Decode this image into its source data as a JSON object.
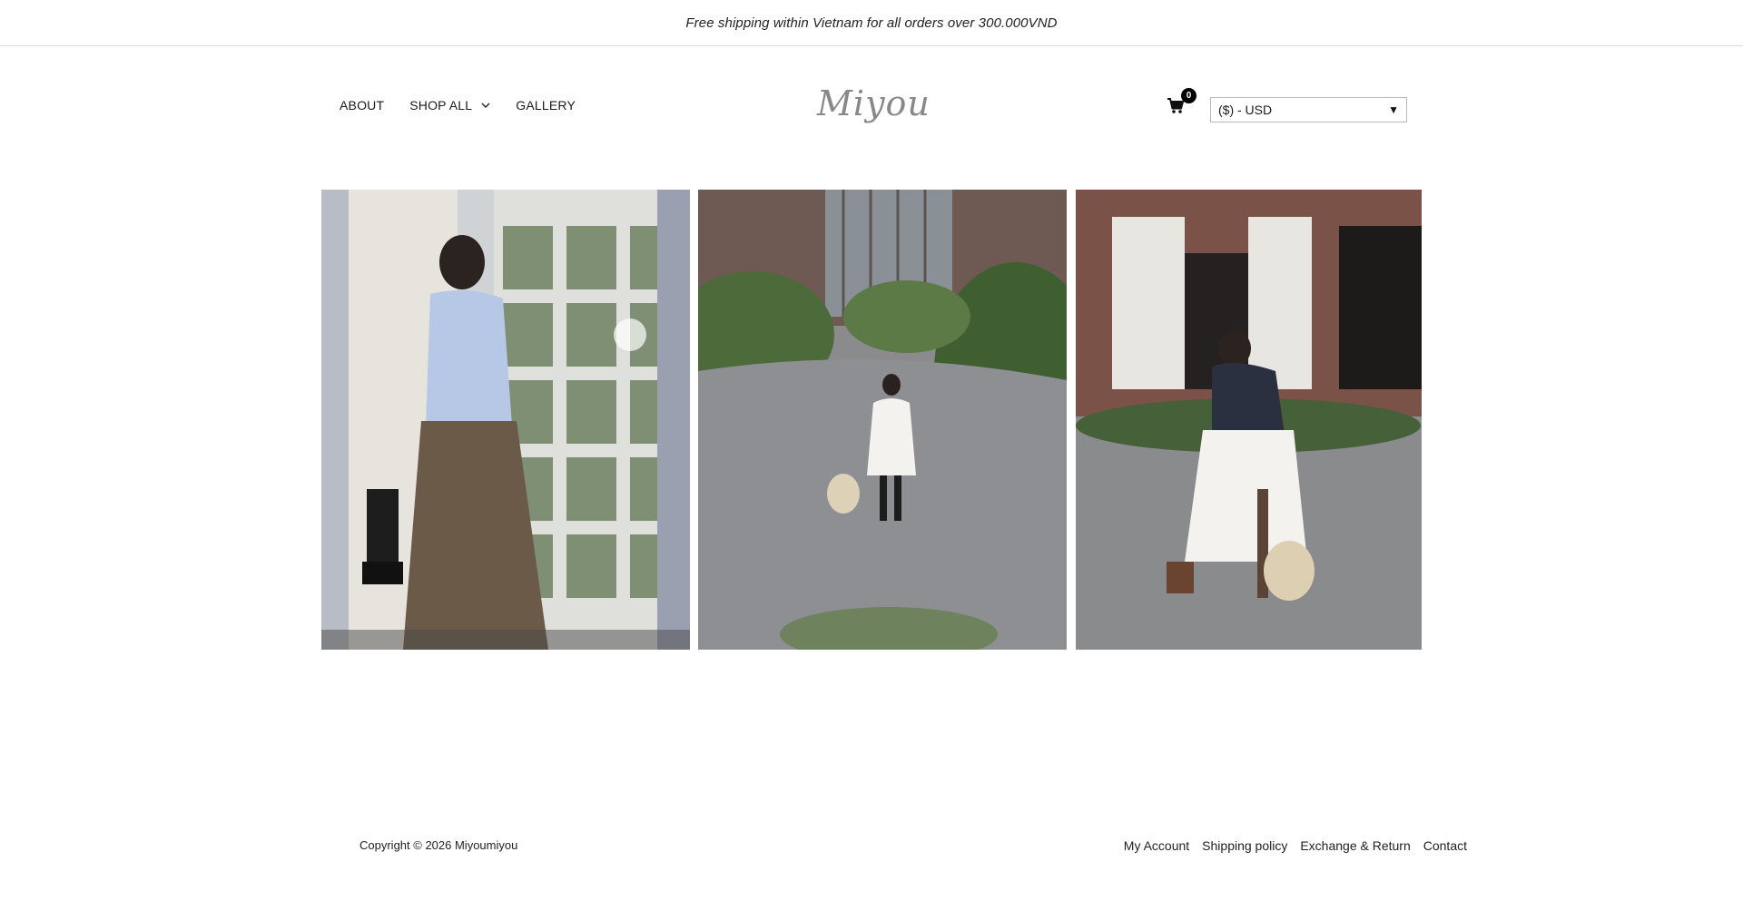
{
  "announcement": {
    "text": "Free shipping within Vietnam for all orders over 300.000VND"
  },
  "nav": {
    "items": [
      {
        "label": "ABOUT"
      },
      {
        "label": "SHOP ALL",
        "has_dropdown": true
      },
      {
        "label": "GALLERY"
      }
    ]
  },
  "logo": {
    "text": "Miyou"
  },
  "cart": {
    "icon": "cart-icon",
    "count": "0"
  },
  "currency": {
    "selected": "($) - USD",
    "icon": "dropdown-arrow-icon"
  },
  "gallery": {
    "images": [
      {
        "name": "gallery-image-1"
      },
      {
        "name": "gallery-image-2"
      },
      {
        "name": "gallery-image-3"
      }
    ]
  },
  "footer": {
    "copyright": "Copyright © 2026 Miyoumiyou",
    "links": [
      "My Account",
      "Shipping policy",
      "Exchange & Return",
      "Contact"
    ]
  },
  "colors": {
    "text": "#1a1a1a",
    "border": "#dcdcdc",
    "badge": "#000000"
  }
}
